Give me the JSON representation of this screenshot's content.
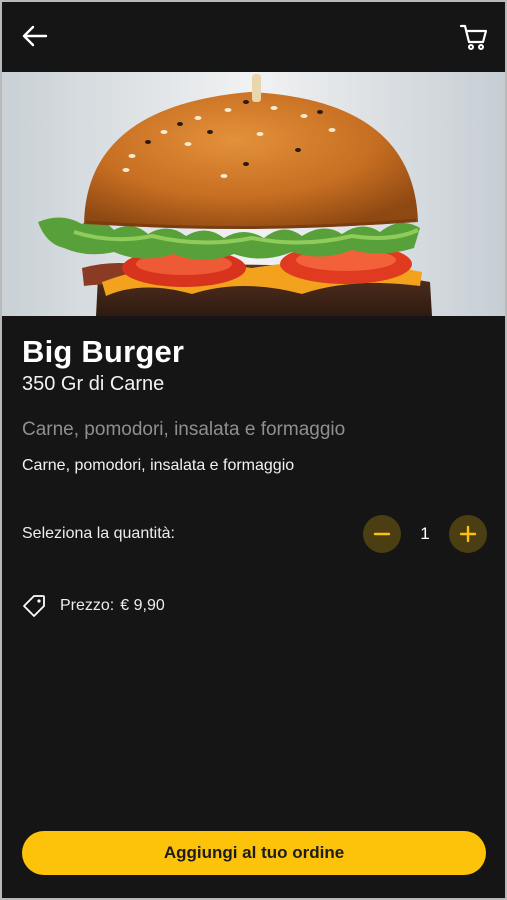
{
  "header": {
    "back_icon": "arrow-left-icon",
    "cart_icon": "shopping-cart-icon"
  },
  "product": {
    "name": "Big Burger",
    "weight": "350 Gr di Carne",
    "description_muted": "Carne, pomodori, insalata e formaggio",
    "description": "Carne, pomodori, insalata e formaggio"
  },
  "quantity": {
    "label": "Seleziona la quantità:",
    "value": "1",
    "minus_icon": "minus-icon",
    "plus_icon": "plus-icon"
  },
  "price": {
    "icon": "price-tag-icon",
    "label": "Prezzo:",
    "value": "€ 9,90"
  },
  "cta": {
    "label": "Aggiungi al tuo ordine"
  },
  "colors": {
    "background": "#151515",
    "accent": "#fcc30a",
    "stepper_bg": "#4a3e12",
    "text": "#ffffff",
    "muted_text": "#8f8f8f"
  }
}
